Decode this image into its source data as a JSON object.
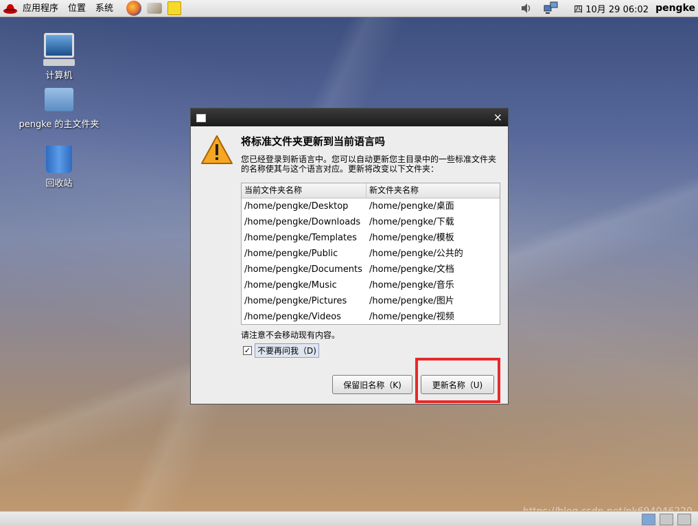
{
  "top_panel": {
    "menus": [
      "应用程序",
      "位置",
      "系统"
    ],
    "clock": "四 10月 29 06:02",
    "user": "pengke"
  },
  "desktop": {
    "icons": [
      {
        "label": "计算机"
      },
      {
        "label": "pengke 的主文件夹"
      },
      {
        "label": "回收站"
      }
    ]
  },
  "dialog": {
    "close_glyph": "×",
    "heading": "将标准文件夹更新到当前语言吗",
    "description": "您已经登录到新语言中。您可以自动更新您主目录中的一些标准文件夹的名称使其与这个语言对应。更新将改变以下文件夹：",
    "table": {
      "columns": [
        "当前文件夹名称",
        "新文件夹名称"
      ],
      "rows": [
        [
          "/home/pengke/Desktop",
          "/home/pengke/桌面"
        ],
        [
          "/home/pengke/Downloads",
          "/home/pengke/下载"
        ],
        [
          "/home/pengke/Templates",
          "/home/pengke/模板"
        ],
        [
          "/home/pengke/Public",
          "/home/pengke/公共的"
        ],
        [
          "/home/pengke/Documents",
          "/home/pengke/文档"
        ],
        [
          "/home/pengke/Music",
          "/home/pengke/音乐"
        ],
        [
          "/home/pengke/Pictures",
          "/home/pengke/图片"
        ],
        [
          "/home/pengke/Videos",
          "/home/pengke/视频"
        ]
      ]
    },
    "note": "请注意不会移动现有内容。",
    "checkbox": {
      "checked_glyph": "✓",
      "label": "不要再问我（D)"
    },
    "buttons": {
      "keep": "保留旧名称（K)",
      "update": "更新名称（U)"
    }
  },
  "watermark": "https://blog.csdn.net/pk694046220",
  "colors": {
    "highlight": "#e8282b",
    "titlebar": "#1b1b1b"
  }
}
